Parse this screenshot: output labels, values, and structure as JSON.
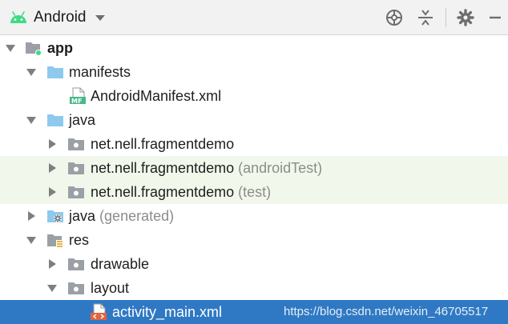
{
  "toolbar": {
    "view_label": "Android",
    "icons": [
      "android-icon",
      "chevron-down-icon",
      "locate-icon",
      "collapse-all-icon",
      "gear-icon",
      "hide-panel-icon"
    ]
  },
  "tree": {
    "app": {
      "label": "app"
    },
    "manifests": {
      "label": "manifests"
    },
    "android_manifest": {
      "label": "AndroidManifest.xml",
      "badge": "MF"
    },
    "java": {
      "label": "java"
    },
    "pkg_main": {
      "label": "net.nell.fragmentdemo"
    },
    "pkg_android_test": {
      "label": "net.nell.fragmentdemo",
      "suffix": "(androidTest)"
    },
    "pkg_test": {
      "label": "net.nell.fragmentdemo",
      "suffix": "(test)"
    },
    "java_generated": {
      "label": "java",
      "suffix": "(generated)"
    },
    "res": {
      "label": "res"
    },
    "drawable": {
      "label": "drawable"
    },
    "layout": {
      "label": "layout"
    },
    "activity_main": {
      "label": "activity_main.xml"
    }
  },
  "watermark": "https://blog.csdn.net/weixin_46705517",
  "colors": {
    "selection": "#2f79c4",
    "highlight_row": "#f1f8eb",
    "folder_blue": "#8ec9ee",
    "package_gray": "#9aa0a6",
    "android_green": "#3ddc84",
    "muted_text": "#8c8c8c"
  }
}
